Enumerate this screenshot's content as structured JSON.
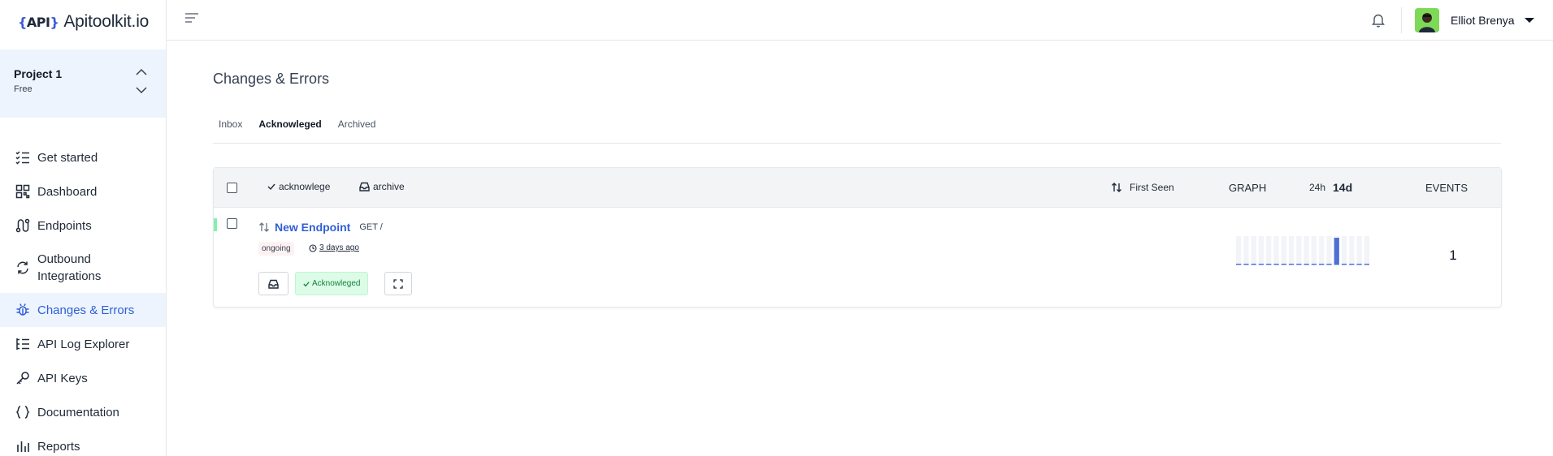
{
  "brand": {
    "mark_open": "{",
    "mark_text": "API",
    "mark_close": "}",
    "name": "Apitoolkit.io"
  },
  "project": {
    "name": "Project 1",
    "plan": "Free"
  },
  "nav": [
    {
      "label": "Get started",
      "icon": "checklist-icon"
    },
    {
      "label": "Dashboard",
      "icon": "qr-grid-icon"
    },
    {
      "label": "Endpoints",
      "icon": "route-icon"
    },
    {
      "label": "Outbound Integrations",
      "icon": "refresh-arrows-icon"
    },
    {
      "label": "Changes & Errors",
      "icon": "bug-icon",
      "active": true
    },
    {
      "label": "API Log Explorer",
      "icon": "list-tree-icon"
    },
    {
      "label": "API Keys",
      "icon": "key-icon"
    },
    {
      "label": "Documentation",
      "icon": "braces-icon"
    },
    {
      "label": "Reports",
      "icon": "bar-chart-icon"
    }
  ],
  "topbar": {
    "user_name": "Elliot Brenya"
  },
  "page": {
    "title": "Changes & Errors"
  },
  "tabs": [
    {
      "label": "Inbox",
      "active": false
    },
    {
      "label": "Acknowleged",
      "active": true
    },
    {
      "label": "Archived",
      "active": false
    }
  ],
  "table": {
    "actions": {
      "acknowledge": "acknowlege",
      "archive": "archive"
    },
    "sort_label": "First Seen",
    "graph_label": "GRAPH",
    "ranges": [
      {
        "label": "24h",
        "active": false
      },
      {
        "label": "14d",
        "active": true
      }
    ],
    "events_label": "EVENTS",
    "rows": [
      {
        "title": "New Endpoint",
        "method": "GET /",
        "status": "ongoing",
        "first_seen": "3 days ago",
        "badge": "Acknowleged",
        "events": "1",
        "graph_values": [
          0,
          0,
          0,
          0,
          0,
          0,
          0,
          0,
          0,
          0,
          0,
          0,
          0,
          1,
          0,
          0,
          0,
          0
        ]
      }
    ]
  },
  "colors": {
    "accent": "#2f5fd6",
    "sidebar_active_bg": "#eef4fd",
    "ack_bg": "#dcfce7",
    "ack_text": "#15803d",
    "graph_bar": "#4f6fd6"
  }
}
